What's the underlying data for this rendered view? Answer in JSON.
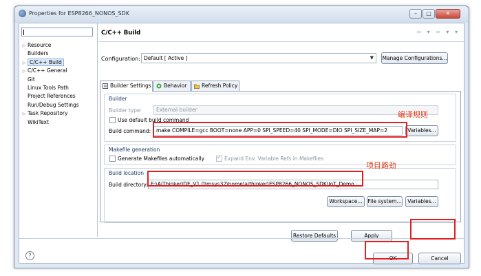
{
  "window": {
    "title": "Properties for ESP8266_NONOS_SDK",
    "close_glyph": "✕",
    "min_glyph": "–",
    "max_glyph": "□"
  },
  "sidebar": {
    "items": [
      {
        "label": "Resource",
        "expandable": true
      },
      {
        "label": "Builders",
        "expandable": false
      },
      {
        "label": "C/C++ Build",
        "expandable": true,
        "selected": true
      },
      {
        "label": "C/C++ General",
        "expandable": true
      },
      {
        "label": "Git",
        "expandable": false
      },
      {
        "label": "Linux Tools Path",
        "expandable": false
      },
      {
        "label": "Project References",
        "expandable": false
      },
      {
        "label": "Run/Debug Settings",
        "expandable": false
      },
      {
        "label": "Task Repository",
        "expandable": true
      },
      {
        "label": "WikiText",
        "expandable": false
      }
    ]
  },
  "header": {
    "title": "C/C++ Build",
    "nav": "⇦ ▾ ⇨ ▾ ▾"
  },
  "configuration": {
    "label": "Configuration:",
    "value": "Default  [ Active ]",
    "manage_label": "Manage Configurations..."
  },
  "tabs": [
    {
      "label": "Builder Settings",
      "active": true
    },
    {
      "label": "Behavior",
      "active": false
    },
    {
      "label": "Refresh Policy",
      "active": false
    }
  ],
  "builder": {
    "group_title": "Builder",
    "type_label": "Builder type:",
    "type_value": "External builder",
    "use_default_label": "Use default build command",
    "command_label": "Build command:",
    "command_value": "make COMPILE=gcc BOOT=none APP=0 SPI_SPEED=40 SPI_MODE=DIO SPI_SIZE_MAP=2",
    "variables_label": "Variables..."
  },
  "makefile": {
    "group_title": "Makefile generation",
    "generate_label": "Generate Makefiles automatically",
    "expand_label": "Expand Env. Variable Refs in Makefiles"
  },
  "location": {
    "group_title": "Build location",
    "directory_label": "Build directory:",
    "directory_value": "E:\\AiThinkerIDE_V1.0\\msys32\\home\\aithinker\\ESP8266_NONOS_SDK\\IoT_Demo",
    "workspace_label": "Workspace...",
    "filesystem_label": "File system...",
    "variables_label": "Variables..."
  },
  "annotations": {
    "build_rule": "编译规则",
    "project_path": "项目路劲"
  },
  "buttons": {
    "restore": "Restore Defaults",
    "apply": "Apply",
    "ok": "OK",
    "cancel": "Cancel",
    "help": "?"
  },
  "colors": {
    "highlight": "#e02020",
    "annotation": "#e23a1a",
    "group_title": "#1c3a66"
  }
}
